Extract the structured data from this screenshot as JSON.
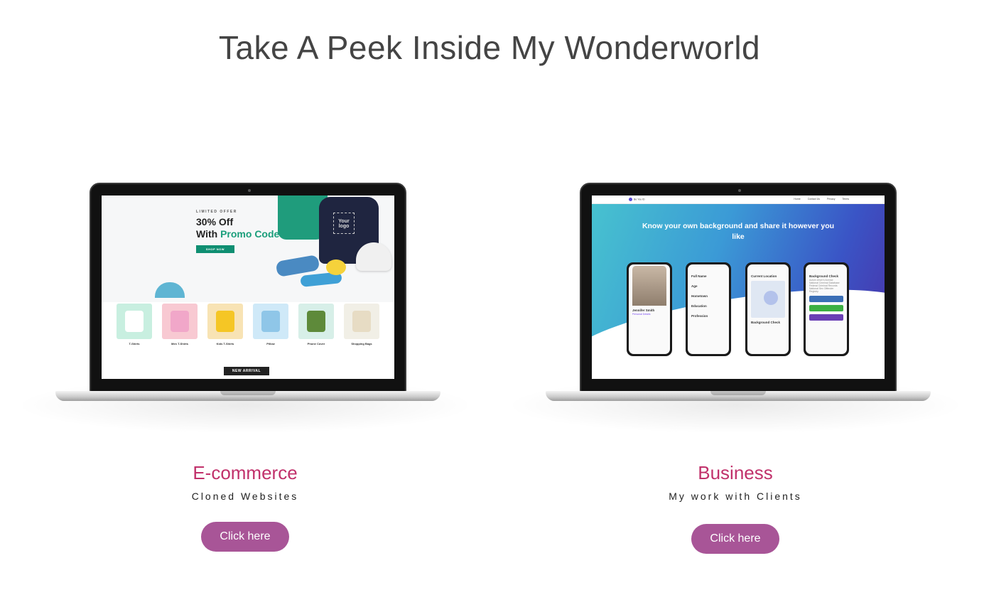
{
  "header": {
    "title": "Take A Peek Inside My Wonderworld"
  },
  "projects": [
    {
      "title": "E-commerce",
      "subtitle": "Cloned Websites",
      "button_label": "Click here",
      "preview": {
        "limited_offer": "LIMITED OFFER",
        "offer_line1": "30% Off",
        "offer_line2_prefix": "With",
        "offer_line2_highlight": "Promo Code",
        "shop_button": "SHOP NOW",
        "shirt_logo": "Your logo",
        "categories": [
          "T-Shirts",
          "Men T-Shirts",
          "Kids T-Shirts",
          "Pillow",
          "Phone Cover",
          "Shopping Bags"
        ],
        "new_arrival": "NEW ARRIVAL"
      }
    },
    {
      "title": "Business",
      "subtitle": "My work with Clients",
      "button_label": "Click here",
      "preview": {
        "brand": "Be You ID",
        "nav_links": [
          "Home",
          "Contact Us",
          "Privacy",
          "Terms"
        ],
        "headline": "Know your own background and share it however you like",
        "phones": [
          {
            "title": "Jennifer Smith",
            "lines": [
              "Personal Details"
            ]
          },
          {
            "title": "Full Name",
            "lines": [
              "Age",
              "Hometown",
              "Education",
              "Profession"
            ]
          },
          {
            "title": "Current Location",
            "lines": [
              "Background Check"
            ]
          },
          {
            "title": "Background Check",
            "lines": [
              "Active driver's license",
              "National Criminal Database",
              "Federal Criminal Records",
              "National Sex Offender Registry"
            ]
          }
        ]
      }
    }
  ],
  "colors": {
    "accent_title": "#c1316b",
    "button": "#a85597",
    "promo_green": "#1a9e7b"
  }
}
